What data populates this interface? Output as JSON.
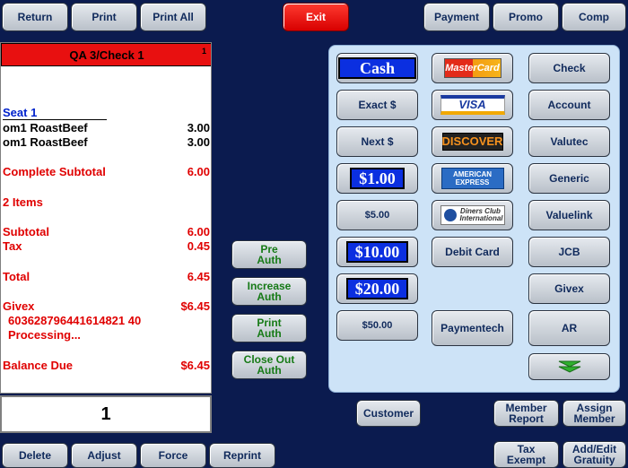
{
  "top_bar": {
    "return": "Return",
    "print": "Print",
    "print_all": "Print All",
    "exit": "Exit",
    "payment": "Payment",
    "promo": "Promo",
    "comp": "Comp"
  },
  "check": {
    "header": "QA 3/Check 1",
    "corner": "1",
    "seat": "Seat 1",
    "items": [
      {
        "name": "om1 RoastBeef",
        "amount": "3.00"
      },
      {
        "name": "om1 RoastBeef",
        "amount": "3.00"
      }
    ],
    "complete_subtotal_label": "Complete Subtotal",
    "complete_subtotal": "6.00",
    "item_count": "2 Items",
    "subtotal_label": "Subtotal",
    "subtotal": "6.00",
    "tax_label": "Tax",
    "tax": "0.45",
    "total_label": "Total",
    "total": "6.45",
    "payment_label": "Givex",
    "payment_amount": "$6.45",
    "card_number": "603628796441614821 40",
    "status": "Processing...",
    "balance_label": "Balance Due",
    "balance": "$6.45",
    "quantity": "1"
  },
  "auth_buttons": {
    "pre_auth": [
      "Pre",
      "Auth"
    ],
    "increase_auth": [
      "Increase",
      "Auth"
    ],
    "print_auth": [
      "Print",
      "Auth"
    ],
    "close_out_auth": [
      "Close Out",
      "Auth"
    ]
  },
  "payment_panel": {
    "cash": "Cash",
    "exact": "Exact $",
    "next": "Next $",
    "one": "$1.00",
    "five": "$5.00",
    "ten": "$10.00",
    "twenty": "$20.00",
    "fifty": "$50.00",
    "mastercard": "MasterCard",
    "visa": "VISA",
    "discover": "DISCOVER",
    "amex": [
      "AMERICAN",
      "EXPRESS"
    ],
    "diners": "Diners Club International",
    "debit": "Debit Card",
    "paymentech": "Paymentech",
    "check": "Check",
    "account": "Account",
    "valutec": "Valutec",
    "generic": "Generic",
    "valuelink": "Valuelink",
    "jcb": "JCB",
    "givex": "Givex",
    "ar": "AR"
  },
  "bottom_right": {
    "customer": "Customer",
    "member_report": [
      "Member",
      "Report"
    ],
    "assign_member": [
      "Assign",
      "Member"
    ],
    "tax_exempt": [
      "Tax",
      "Exempt"
    ],
    "add_edit_gratuity": [
      "Add/Edit",
      "Gratuity"
    ]
  },
  "bottom_bar": {
    "delete": "Delete",
    "adjust": "Adjust",
    "force": "Force",
    "reprint": "Reprint"
  }
}
